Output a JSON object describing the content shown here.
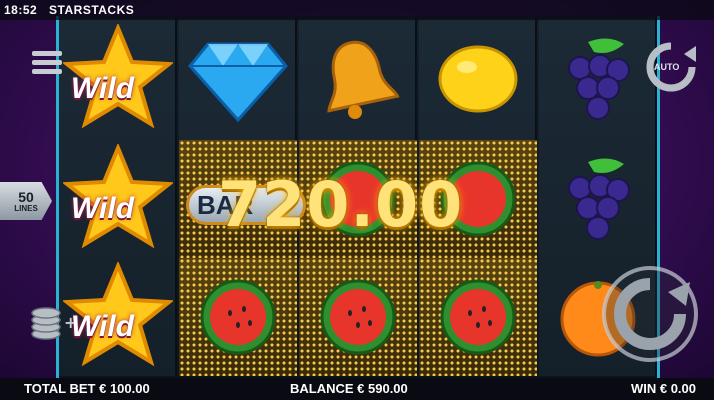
{
  "status": {
    "time": "18:52",
    "game_title": "STARSTACKS"
  },
  "lines": {
    "count": "50",
    "label": "LINES"
  },
  "win_amount_display": "720.00",
  "bar_symbol_text": "BAR",
  "wild_label": "Wild",
  "auto_label": "AUTO",
  "reels": [
    [
      "wild",
      "wild",
      "wild"
    ],
    [
      "diamond",
      "bar",
      "watermelon"
    ],
    [
      "bell",
      "watermelon",
      "watermelon"
    ],
    [
      "lemon",
      "watermelon",
      "watermelon"
    ],
    [
      "grapes",
      "grapes",
      "orange"
    ]
  ],
  "footer": {
    "total_bet": "TOTAL BET € 100.00",
    "balance": "BALANCE € 590.00",
    "win": "WIN € 0.00"
  },
  "colors": {
    "accent": "#2bb0d6",
    "gold": "#ffe27a",
    "background": "#3b0f5c"
  }
}
